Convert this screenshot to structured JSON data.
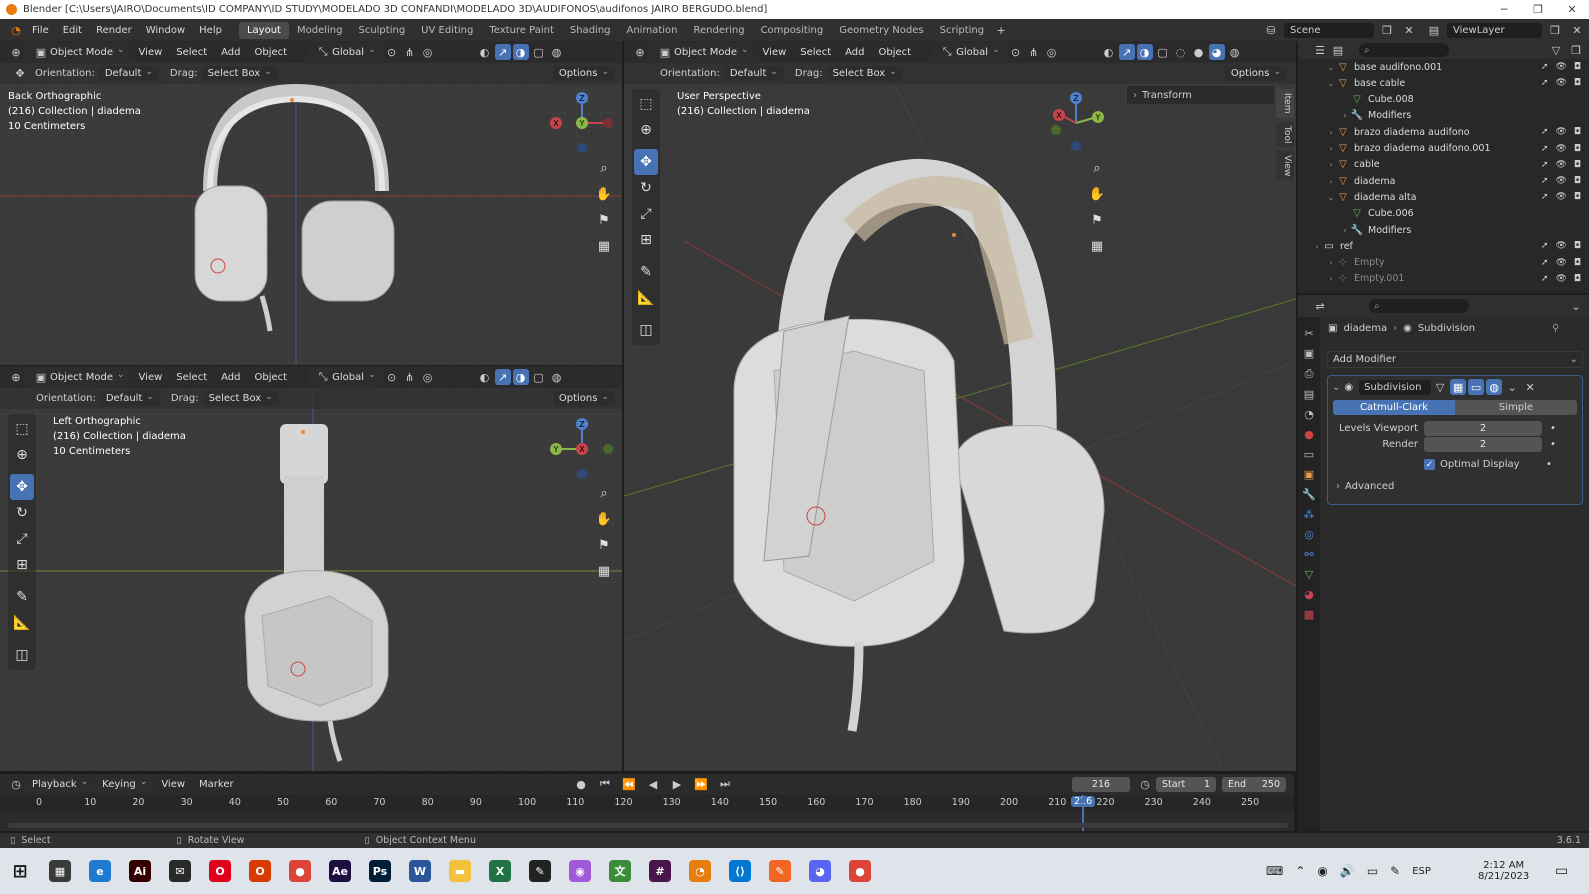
{
  "window": {
    "title": "Blender [C:\\Users\\JAIRO\\Documents\\ID COMPANY\\ID STUDY\\MODELADO 3D CONFANDI\\MODELADO 3D\\AUDIFONOS\\audifonos JAIRO BERGUDO.blend]",
    "minimize": "─",
    "maximize": "❐",
    "close": "✕"
  },
  "menu": [
    "File",
    "Edit",
    "Render",
    "Window",
    "Help"
  ],
  "workspaces": [
    "Layout",
    "Modeling",
    "Sculpting",
    "UV Editing",
    "Texture Paint",
    "Shading",
    "Animation",
    "Rendering",
    "Compositing",
    "Geometry Nodes",
    "Scripting"
  ],
  "active_workspace": "Layout",
  "scene": "Scene",
  "view_layer": "ViewLayer",
  "viewport_header": {
    "mode": "Object Mode",
    "view": "View",
    "select": "Select",
    "add": "Add",
    "object": "Object",
    "transform": "Global",
    "orientation_label": "Orientation:",
    "orientation_value": "Default",
    "drag_label": "Drag:",
    "drag_value": "Select Box",
    "options": "Options"
  },
  "viewports": {
    "back": {
      "view": "Back Orthographic",
      "collection": "(216) Collection | diadema",
      "scale": "10 Centimeters"
    },
    "left": {
      "view": "Left Orthographic",
      "collection": "(216) Collection | diadema",
      "scale": "10 Centimeters"
    },
    "persp": {
      "view": "User Perspective",
      "collection": "(216) Collection | diadema"
    }
  },
  "gizmo_labels": {
    "x": "X",
    "y": "Y",
    "z": "Z"
  },
  "sidebar_panel": {
    "transform": "Transform",
    "tabs": [
      "Item",
      "Tool",
      "View"
    ]
  },
  "outliner": {
    "items": [
      {
        "name": "base audifono.001",
        "indent": 2,
        "icon": "mesh",
        "expanded": true
      },
      {
        "name": "base cable",
        "indent": 2,
        "icon": "mesh",
        "expanded": true
      },
      {
        "name": "Cube.008",
        "indent": 3,
        "icon": "mesh-data"
      },
      {
        "name": "Modifiers",
        "indent": 3,
        "icon": "wrench"
      },
      {
        "name": "brazo diadema audifono",
        "indent": 2,
        "icon": "mesh"
      },
      {
        "name": "brazo diadema audifono.001",
        "indent": 2,
        "icon": "mesh"
      },
      {
        "name": "cable",
        "indent": 2,
        "icon": "mesh"
      },
      {
        "name": "diadema",
        "indent": 2,
        "icon": "mesh"
      },
      {
        "name": "diadema alta",
        "indent": 2,
        "icon": "mesh",
        "expanded": true
      },
      {
        "name": "Cube.006",
        "indent": 3,
        "icon": "mesh-data"
      },
      {
        "name": "Modifiers",
        "indent": 3,
        "icon": "wrench"
      },
      {
        "name": "ref",
        "indent": 1,
        "icon": "collection"
      },
      {
        "name": "Empty",
        "indent": 2,
        "icon": "empty"
      },
      {
        "name": "Empty.001",
        "indent": 2,
        "icon": "empty"
      }
    ]
  },
  "properties": {
    "breadcrumb_object": "diadema",
    "breadcrumb_modifier": "Subdivision",
    "add_modifier": "Add Modifier",
    "modifier_name": "Subdivision",
    "mode_a": "Catmull-Clark",
    "mode_b": "Simple",
    "levels_viewport_label": "Levels Viewport",
    "levels_viewport": "2",
    "render_label": "Render",
    "render_value": "2",
    "optimal_display": "Optimal Display",
    "advanced": "Advanced"
  },
  "timeline": {
    "playback": "Playback",
    "keying": "Keying",
    "view": "View",
    "marker": "Marker",
    "current_frame": "216",
    "start_label": "Start",
    "start": "1",
    "end_label": "End",
    "end": "250",
    "ticks": [
      "0",
      "10",
      "20",
      "30",
      "40",
      "50",
      "60",
      "70",
      "80",
      "90",
      "100",
      "110",
      "120",
      "130",
      "140",
      "150",
      "160",
      "170",
      "180",
      "190",
      "200",
      "210",
      "220",
      "230",
      "240",
      "250"
    ]
  },
  "status": {
    "left": "Select",
    "middle": "Rotate View",
    "right": "Object Context Menu",
    "version": "3.6.1"
  },
  "taskbar": {
    "time": "2:12 AM",
    "date": "8/21/2023",
    "lang": "ESP",
    "apps": [
      {
        "name": "calculator",
        "color": "#3a3a3a",
        "glyph": "▦"
      },
      {
        "name": "edge",
        "color": "#1f7bd1",
        "glyph": "e"
      },
      {
        "name": "illustrator",
        "color": "#330000",
        "glyph": "Ai"
      },
      {
        "name": "mail",
        "color": "#2a2a2a",
        "glyph": "✉"
      },
      {
        "name": "opera",
        "color": "#e0001b",
        "glyph": "O"
      },
      {
        "name": "office",
        "color": "#d83b01",
        "glyph": "O"
      },
      {
        "name": "chrome",
        "color": "#db4437",
        "glyph": "●"
      },
      {
        "name": "after-effects",
        "color": "#1a0f3d",
        "glyph": "Ae"
      },
      {
        "name": "photoshop",
        "color": "#001e36",
        "glyph": "Ps"
      },
      {
        "name": "word",
        "color": "#2b579a",
        "glyph": "W"
      },
      {
        "name": "explorer",
        "color": "#f3c13a",
        "glyph": "▬"
      },
      {
        "name": "excel",
        "color": "#217346",
        "glyph": "X"
      },
      {
        "name": "inkscape",
        "color": "#222",
        "glyph": "✎"
      },
      {
        "name": "app-color",
        "color": "#a05ad8",
        "glyph": "◉"
      },
      {
        "name": "translator",
        "color": "#3c8c3c",
        "glyph": "文"
      },
      {
        "name": "slack",
        "color": "#4a154b",
        "glyph": "#"
      },
      {
        "name": "blender",
        "color": "#e87d0d",
        "glyph": "◔"
      },
      {
        "name": "vscode",
        "color": "#0078d4",
        "glyph": "⟨⟩"
      },
      {
        "name": "sketch",
        "color": "#f26522",
        "glyph": "✎"
      },
      {
        "name": "discord",
        "color": "#5865f2",
        "glyph": "◕"
      },
      {
        "name": "chrome-2",
        "color": "#db4437",
        "glyph": "●"
      }
    ]
  }
}
